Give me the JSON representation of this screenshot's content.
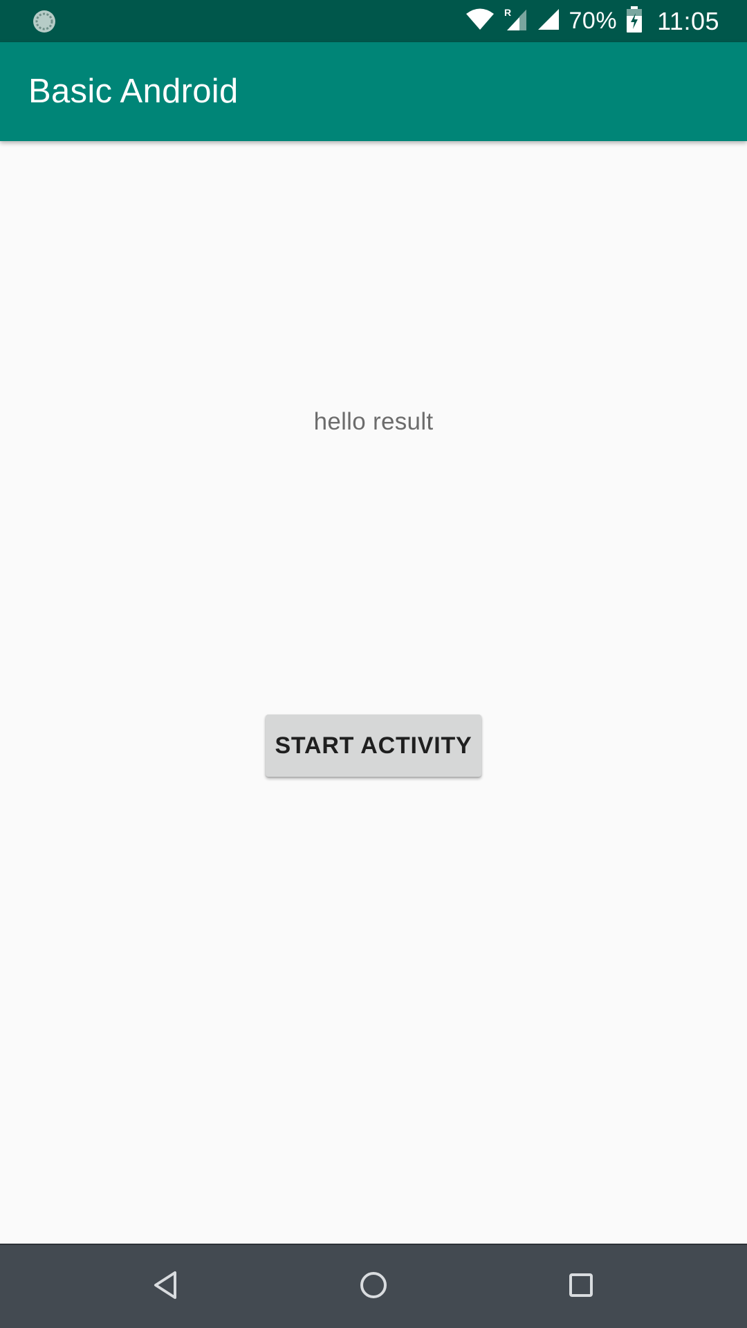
{
  "status_bar": {
    "battery_percent": "70%",
    "time": "11:05",
    "icons": [
      "sync-icon",
      "wifi-icon",
      "roaming-signal-icon",
      "cell-signal-icon",
      "battery-charging-icon"
    ]
  },
  "app_bar": {
    "title": "Basic Android"
  },
  "main": {
    "result_text": "hello result",
    "start_button_label": "START ACTIVITY"
  },
  "nav_bar": {
    "icons": [
      "back-icon",
      "home-icon",
      "recents-icon"
    ]
  },
  "colors": {
    "status_bar": "#00574b",
    "app_bar": "#008577",
    "background": "#fafafa",
    "button": "#d6d7d7",
    "nav_bar": "#434a51"
  }
}
